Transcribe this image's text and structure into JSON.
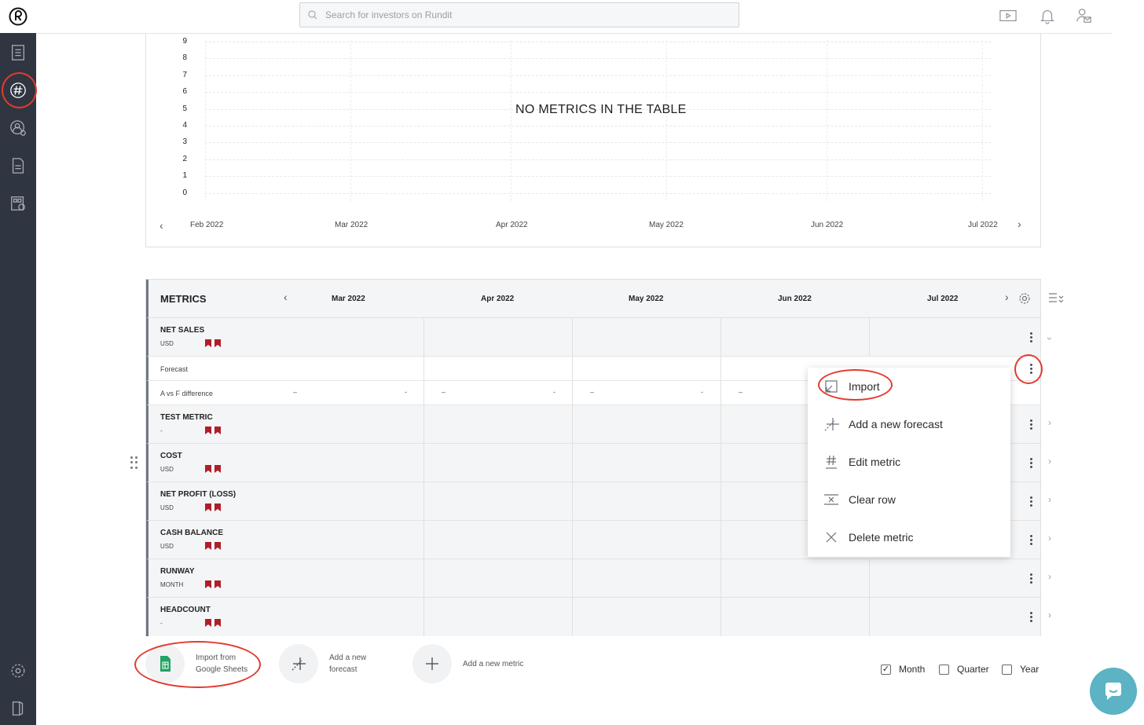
{
  "search": {
    "placeholder": "Search for investors on Rundit"
  },
  "chart": {
    "empty_message": "NO METRICS IN THE TABLE",
    "y_ticks": [
      "9",
      "8",
      "7",
      "6",
      "5",
      "4",
      "3",
      "2",
      "1",
      "0"
    ],
    "x_ticks": [
      "Feb 2022",
      "Mar 2022",
      "Apr 2022",
      "May 2022",
      "Jun 2022",
      "Jul 2022"
    ]
  },
  "chart_data": {
    "type": "line",
    "categories": [
      "Feb 2022",
      "Mar 2022",
      "Apr 2022",
      "May 2022",
      "Jun 2022",
      "Jul 2022"
    ],
    "series": [],
    "title": "NO METRICS IN THE TABLE",
    "ylim": [
      0,
      9
    ],
    "grid": true
  },
  "table": {
    "title": "METRICS",
    "months": [
      "Mar 2022",
      "Apr 2022",
      "May 2022",
      "Jun 2022",
      "Jul 2022"
    ],
    "rows": [
      {
        "name": "NET SALES",
        "unit": "USD"
      },
      {
        "name": "TEST METRIC",
        "unit": "-"
      },
      {
        "name": "COST",
        "unit": "USD"
      },
      {
        "name": "NET PROFIT (LOSS)",
        "unit": "USD"
      },
      {
        "name": "CASH BALANCE",
        "unit": "USD"
      },
      {
        "name": "RUNWAY",
        "unit": "MONTH"
      },
      {
        "name": "HEADCOUNT",
        "unit": "-"
      }
    ],
    "forecast_label": "Forecast",
    "diff_label": "A vs F difference",
    "dash": "–",
    "dash_short": "-"
  },
  "menu": {
    "items": [
      "Import",
      "Add a new forecast",
      "Edit metric",
      "Clear row",
      "Delete metric"
    ]
  },
  "actions": {
    "import_sheets": "Import from Google Sheets",
    "add_forecast": "Add a new forecast",
    "add_metric": "Add a new metric"
  },
  "periods": {
    "month": "Month",
    "quarter": "Quarter",
    "year": "Year",
    "month_checked": true,
    "quarter_checked": false,
    "year_checked": false
  },
  "colors": {
    "sidebar": "#2f3541",
    "flag": "#b01e2a",
    "highlight_ring": "#e23b2e",
    "chat": "#5bb3c4"
  }
}
